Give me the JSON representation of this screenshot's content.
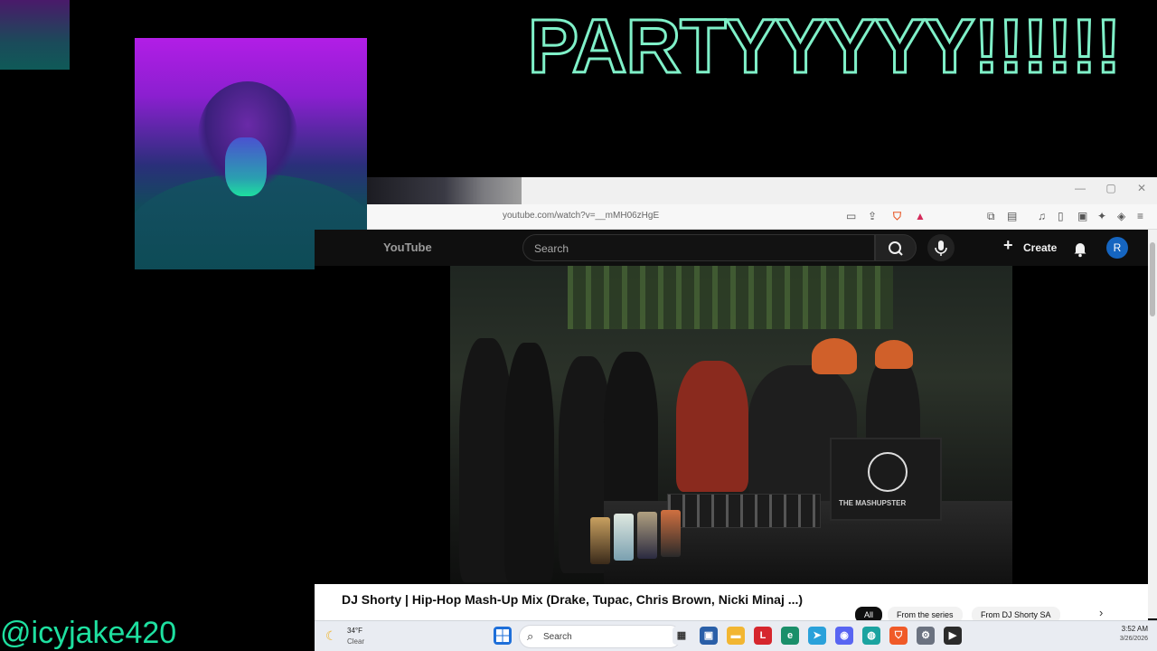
{
  "overlay": {
    "title": "PARTYYYYY!!!!!!",
    "handle": "@icyjake420"
  },
  "browser": {
    "url": "youtube.com/watch?v=__mMH06zHgE",
    "window_controls": {
      "minimize": "—",
      "maximize": "▢",
      "close": "✕"
    }
  },
  "youtube": {
    "logo": "YouTube",
    "search_placeholder": "Search",
    "create_label": "Create",
    "avatar_letter": "R",
    "video_title": "DJ Shorty | Hip-Hop Mash-Up Mix (Drake, Tupac, Chris Brown, Nicki Minaj ...)",
    "chips": [
      "All",
      "From the series",
      "From DJ Shorty SA"
    ],
    "laptop_text": "THE MASHUPSTER"
  },
  "taskbar": {
    "weather_temp": "34°F",
    "weather_cond": "Clear",
    "search_label": "Search",
    "time": "3:52 AM",
    "date": "3/26/2026"
  },
  "colors": {
    "title_outline": "#7ff0c8",
    "handle": "#1ee0a0",
    "yt_bg": "#0f0f0f",
    "avatar": "#1565c0"
  }
}
